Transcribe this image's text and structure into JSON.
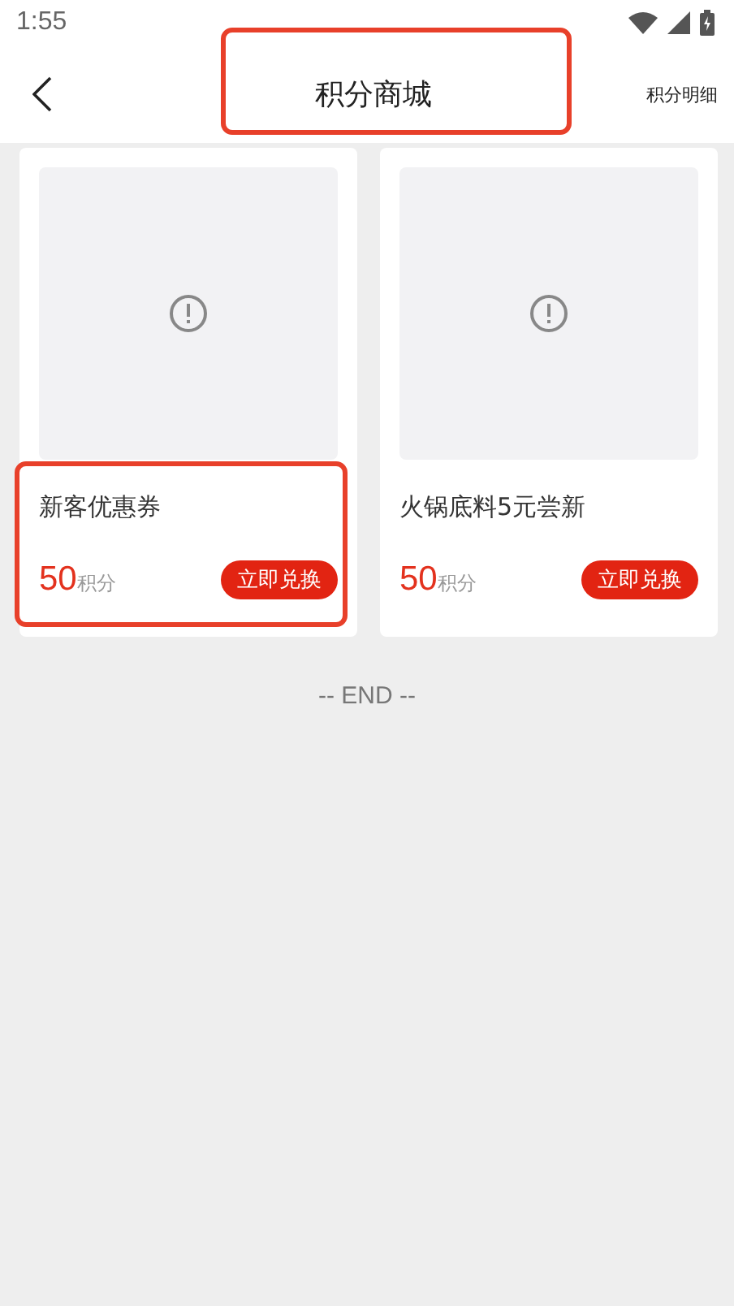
{
  "status_bar": {
    "time": "1:55"
  },
  "header": {
    "title": "积分商城",
    "title_highlighted": true,
    "action": "积分明细"
  },
  "products": [
    {
      "name": "新客优惠券",
      "points": "50",
      "points_unit": "积分",
      "button": "立即兑换",
      "highlighted": true
    },
    {
      "name": "火锅底料5元尝新",
      "points": "50",
      "points_unit": "积分",
      "button": "立即兑换",
      "highlighted": false
    }
  ],
  "end_text": "-- END --"
}
